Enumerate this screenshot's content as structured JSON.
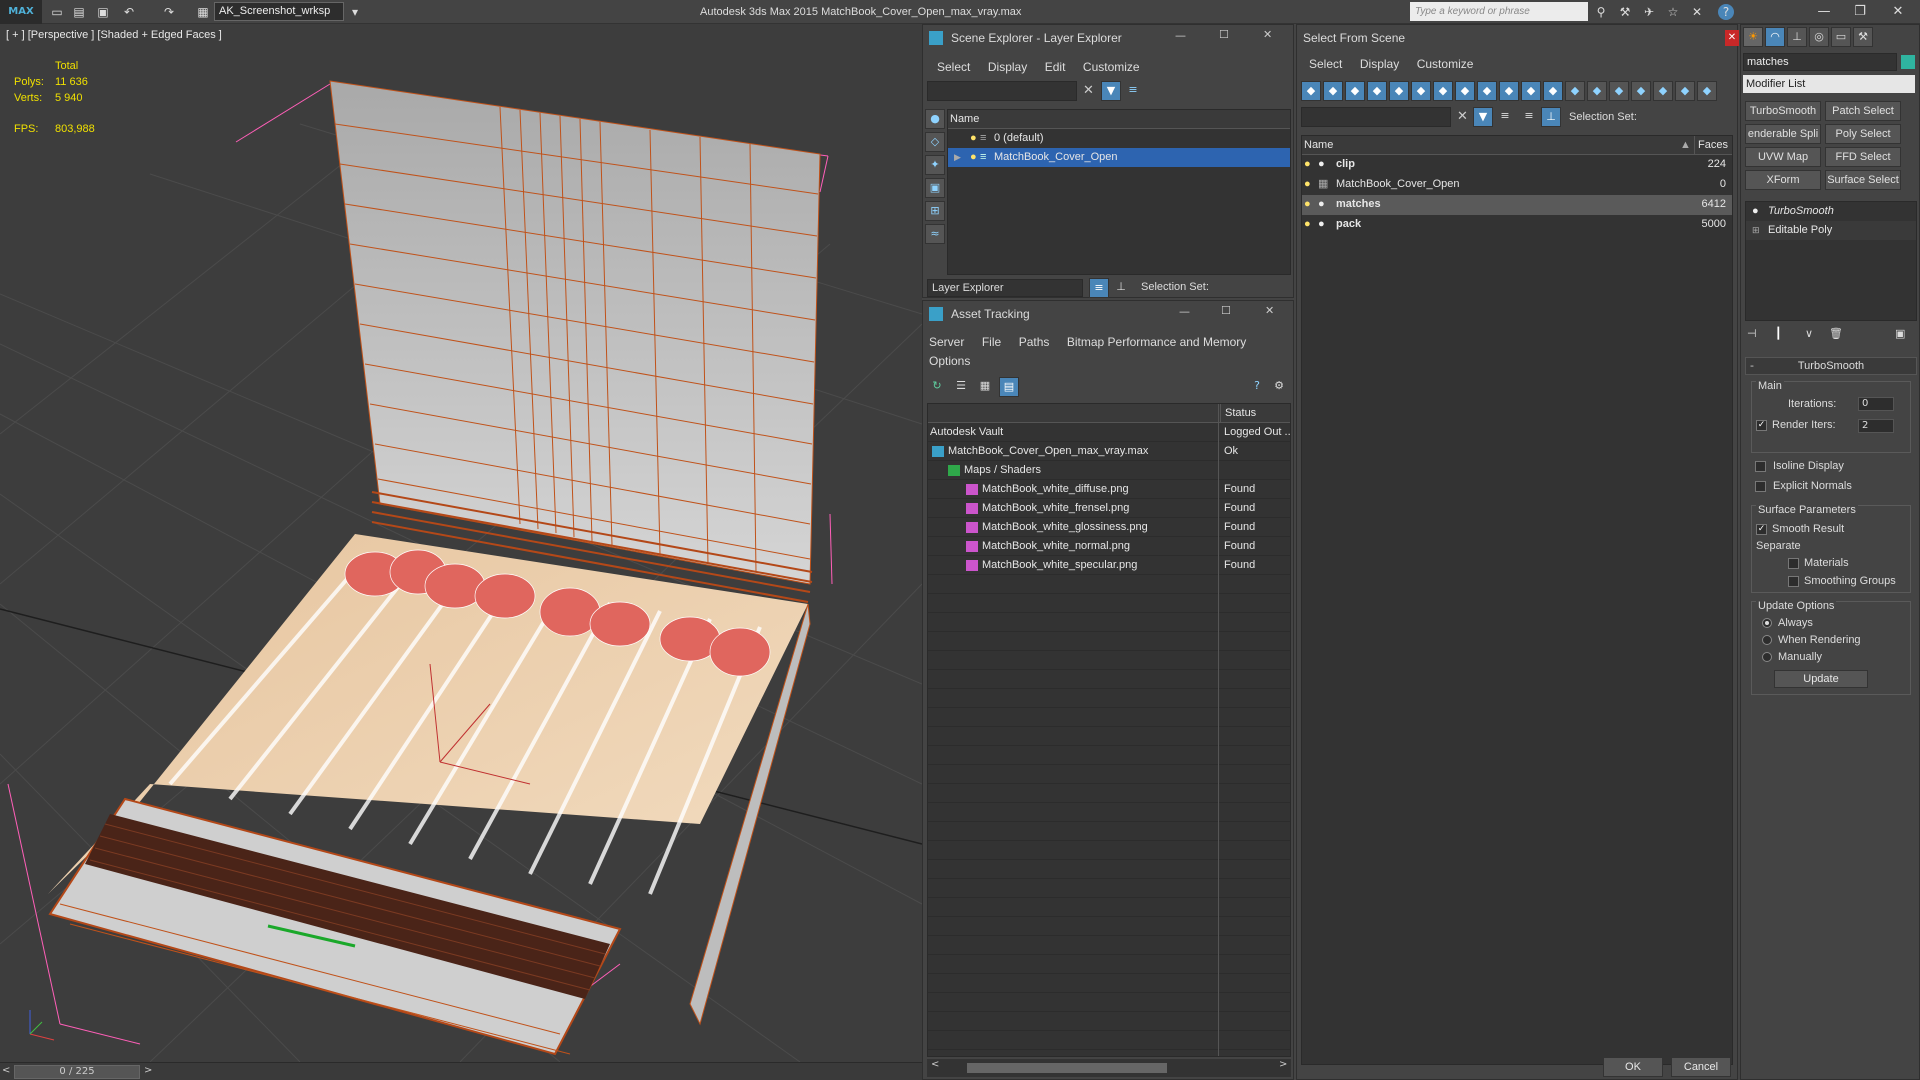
{
  "app": {
    "logo": "MAX",
    "workspace": "AK_Screenshot_wrksp",
    "title": "Autodesk 3ds Max  2015     MatchBook_Cover_Open_max_vray.max",
    "search_placeholder": "Type a keyword or phrase"
  },
  "viewport": {
    "label": "[ + ] [Perspective ] [Shaded + Edged Faces ]",
    "stats": {
      "total_label": "Total",
      "polys_label": "Polys:",
      "polys_value": "11 636",
      "verts_label": "Verts:",
      "verts_value": "5 940",
      "fps_label": "FPS:",
      "fps_value": "803,988"
    },
    "timeline": "0 / 225"
  },
  "scene_explorer": {
    "title": "Scene Explorer - Layer Explorer",
    "menu": [
      "Select",
      "Display",
      "Edit",
      "Customize"
    ],
    "column_name": "Name",
    "rows": [
      {
        "label": "0 (default)"
      },
      {
        "label": "MatchBook_Cover_Open"
      }
    ],
    "footer_dropdown": "Layer Explorer",
    "selection_set_label": "Selection Set:"
  },
  "asset_tracking": {
    "title": "Asset Tracking",
    "menu": [
      "Server",
      "File",
      "Paths",
      "Bitmap Performance and Memory"
    ],
    "menu2": "Options",
    "col_status": "Status",
    "rows": [
      {
        "name": "Autodesk Vault",
        "status": "Logged Out ..."
      },
      {
        "name": "MatchBook_Cover_Open_max_vray.max",
        "status": "Ok"
      },
      {
        "name": "Maps / Shaders",
        "status": ""
      },
      {
        "name": "MatchBook_white_diffuse.png",
        "status": "Found"
      },
      {
        "name": "MatchBook_white_frensel.png",
        "status": "Found"
      },
      {
        "name": "MatchBook_white_glossiness.png",
        "status": "Found"
      },
      {
        "name": "MatchBook_white_normal.png",
        "status": "Found"
      },
      {
        "name": "MatchBook_white_specular.png",
        "status": "Found"
      }
    ]
  },
  "select_from_scene": {
    "title": "Select From Scene",
    "menu": [
      "Select",
      "Display",
      "Customize"
    ],
    "selection_set_label": "Selection Set:",
    "col_name": "Name",
    "col_faces": "Faces",
    "rows": [
      {
        "name": "clip",
        "faces": "224"
      },
      {
        "name": "MatchBook_Cover_Open",
        "faces": "0"
      },
      {
        "name": "matches",
        "faces": "6412"
      },
      {
        "name": "pack",
        "faces": "5000"
      }
    ],
    "ok": "OK",
    "cancel": "Cancel"
  },
  "command_panel": {
    "object_name": "matches",
    "modifier_list": "Modifier List",
    "mod_buttons": [
      "TurboSmooth",
      "Patch Select",
      "enderable Spli",
      "Poly Select",
      "UVW Map",
      "FFD Select",
      "XForm",
      "Surface Select"
    ],
    "stack": [
      "TurboSmooth",
      "Editable Poly"
    ],
    "rollout_title": "TurboSmooth",
    "main_label": "Main",
    "iterations_label": "Iterations:",
    "iterations_value": "0",
    "render_iters_label": "Render Iters:",
    "render_iters_value": "2",
    "isoline_label": "Isoline Display",
    "explicit_normals_label": "Explicit Normals",
    "surface_params_label": "Surface Parameters",
    "smooth_result_label": "Smooth Result",
    "separate_label": "Separate",
    "materials_label": "Materials",
    "smoothing_groups_label": "Smoothing Groups",
    "update_options_label": "Update Options",
    "always_label": "Always",
    "when_rendering_label": "When Rendering",
    "manually_label": "Manually",
    "update_button": "Update"
  }
}
